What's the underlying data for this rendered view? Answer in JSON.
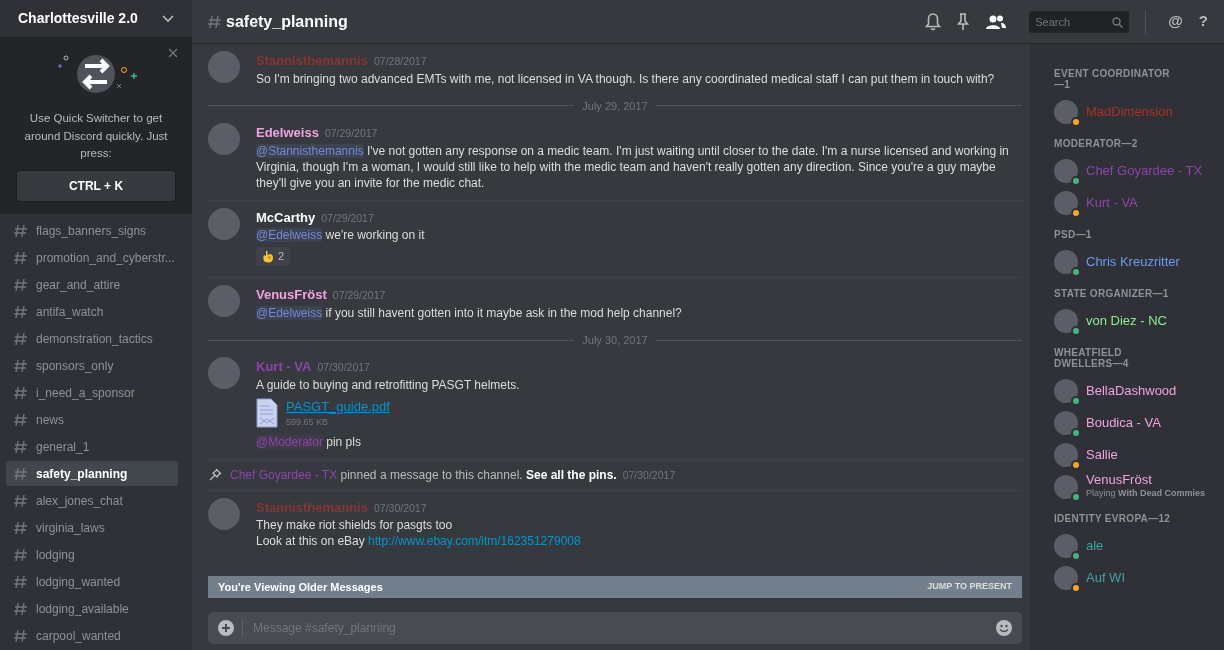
{
  "server": {
    "name": "Charlottesville 2.0"
  },
  "quick_switcher": {
    "message": "Use Quick Switcher to get around Discord quickly. Just press:",
    "shortcut": "CTRL + K"
  },
  "channels": [
    {
      "name": "flags_banners_signs",
      "selected": false
    },
    {
      "name": "promotion_and_cyberstr...",
      "selected": false
    },
    {
      "name": "gear_and_attire",
      "selected": false
    },
    {
      "name": "antifa_watch",
      "selected": false
    },
    {
      "name": "demonstration_tactics",
      "selected": false
    },
    {
      "name": "sponsors_only",
      "selected": false
    },
    {
      "name": "i_need_a_sponsor",
      "selected": false
    },
    {
      "name": "news",
      "selected": false
    },
    {
      "name": "general_1",
      "selected": false
    },
    {
      "name": "safety_planning",
      "selected": true
    },
    {
      "name": "alex_jones_chat",
      "selected": false
    },
    {
      "name": "virginia_laws",
      "selected": false
    },
    {
      "name": "lodging",
      "selected": false
    },
    {
      "name": "lodging_wanted",
      "selected": false
    },
    {
      "name": "lodging_available",
      "selected": false
    },
    {
      "name": "carpool_wanted",
      "selected": false
    }
  ],
  "header": {
    "channel": "safety_planning",
    "mentions_button": "@",
    "help_button": "?"
  },
  "search": {
    "placeholder": "Search"
  },
  "messages": [
    {
      "kind": "message",
      "author": "Stannisthemannis",
      "color": "#8a3434",
      "time": "07/28/2017",
      "blocks": [
        {
          "kind": "text",
          "parts": [
            {
              "kind": "plain",
              "text": "So I'm bringing two advanced EMTs with me, not licensed in VA though.  Is there any coordinated medical staff I can put them in touch with?"
            }
          ]
        }
      ]
    },
    {
      "kind": "divider",
      "label": "July 29, 2017"
    },
    {
      "kind": "message",
      "author": "Edelweiss",
      "color": "#f1a2e0",
      "time": "07/29/2017",
      "blocks": [
        {
          "kind": "text",
          "parts": [
            {
              "kind": "mention",
              "text": "@Stannisthemannis",
              "color": "#7289da"
            },
            {
              "kind": "plain",
              "text": " I've not gotten any response on a medic team. I'm just waiting until closer to the date. I'm a nurse licensed and working in Virginia, though I'm a woman, I would still like to help with the medic team and haven't really gotten any direction. Since you're a guy maybe they'll give you an invite for the medic chat."
            }
          ]
        }
      ]
    },
    {
      "kind": "message",
      "author": "McCarthy",
      "color": "#ffffff",
      "time": "07/29/2017",
      "blocks": [
        {
          "kind": "text",
          "parts": [
            {
              "kind": "mention",
              "text": "@Edelweiss",
              "color": "#7289da"
            },
            {
              "kind": "plain",
              "text": " we're working on it"
            }
          ]
        },
        {
          "kind": "reaction",
          "count": "2"
        }
      ]
    },
    {
      "kind": "message",
      "author": "VenusFröst",
      "color": "#f1a2e0",
      "time": "07/29/2017",
      "blocks": [
        {
          "kind": "text",
          "parts": [
            {
              "kind": "mention",
              "text": "@Edelweiss",
              "color": "#7289da"
            },
            {
              "kind": "plain",
              "text": " if you still havent gotten into it maybe ask in the mod help channel?"
            }
          ]
        }
      ]
    },
    {
      "kind": "divider",
      "label": "July 30, 2017"
    },
    {
      "kind": "message",
      "author": "Kurt - VA",
      "color": "#8e44ad",
      "time": "07/30/2017",
      "blocks": [
        {
          "kind": "text",
          "parts": [
            {
              "kind": "plain",
              "text": "A guide to buying and retrofitting PASGT helmets."
            }
          ]
        },
        {
          "kind": "attachment",
          "filename": "PASGT_guide.pdf",
          "size": "599.65 KB"
        },
        {
          "kind": "text",
          "parts": [
            {
              "kind": "mention",
              "text": "@Moderator",
              "color": "#8e44ad"
            },
            {
              "kind": "plain",
              "text": " pin pls"
            }
          ]
        }
      ]
    },
    {
      "kind": "system",
      "actor": "Chef Goyardee - TX",
      "color": "#8e44ad",
      "text": "pinned a message to this channel.",
      "link": "See all the pins.",
      "time": "07/30/2017"
    },
    {
      "kind": "message",
      "author": "Stannisthemannis",
      "color": "#8a3434",
      "time": "07/30/2017",
      "blocks": [
        {
          "kind": "text",
          "parts": [
            {
              "kind": "plain",
              "text": "They make riot shields for pasgts too"
            }
          ]
        },
        {
          "kind": "text",
          "parts": [
            {
              "kind": "plain",
              "text": "Look at this on eBay "
            },
            {
              "kind": "link",
              "text": "http://www.ebay.com/itm/162351279008"
            }
          ]
        }
      ]
    }
  ],
  "jump_bar": {
    "text": "You're Viewing Older Messages",
    "action": "JUMP TO PRESENT"
  },
  "composer": {
    "placeholder": "Message #safety_planning"
  },
  "member_groups": [
    {
      "title": "EVENT COORDINATOR—1",
      "members": [
        {
          "name": "MadDimension",
          "color": "#a93226",
          "idle": true
        }
      ]
    },
    {
      "title": "MODERATOR—2",
      "members": [
        {
          "name": "Chef Goyardee - TX",
          "color": "#8e44ad",
          "idle": false
        },
        {
          "name": "Kurt - VA",
          "color": "#8e44ad",
          "idle": true
        }
      ]
    },
    {
      "title": "PSD—1",
      "members": [
        {
          "name": "Chris Kreuzritter",
          "color": "#6c9af0",
          "idle": false
        }
      ]
    },
    {
      "title": "STATE ORGANIZER—1",
      "members": [
        {
          "name": "von Diez - NC",
          "color": "#88f08f",
          "idle": false
        }
      ]
    },
    {
      "title": "WHEATFIELD DWELLERS—4",
      "members": [
        {
          "name": "BellaDashwood",
          "color": "#f1a2e0",
          "idle": false
        },
        {
          "name": "Boudica - VA",
          "color": "#f1a2e0",
          "idle": false
        },
        {
          "name": "Sallie",
          "color": "#f1a2e0",
          "idle": true
        },
        {
          "name": "VenusFröst",
          "color": "#f1a2e0",
          "idle": false,
          "activity": "Playing **With Dead Commies**"
        }
      ]
    },
    {
      "title": "IDENTITY EVROPA—12",
      "members": [
        {
          "name": "ale",
          "color": "#3fa3a8",
          "idle": false
        },
        {
          "name": "Auf WI",
          "color": "#3fa3a8",
          "idle": true
        }
      ]
    }
  ]
}
